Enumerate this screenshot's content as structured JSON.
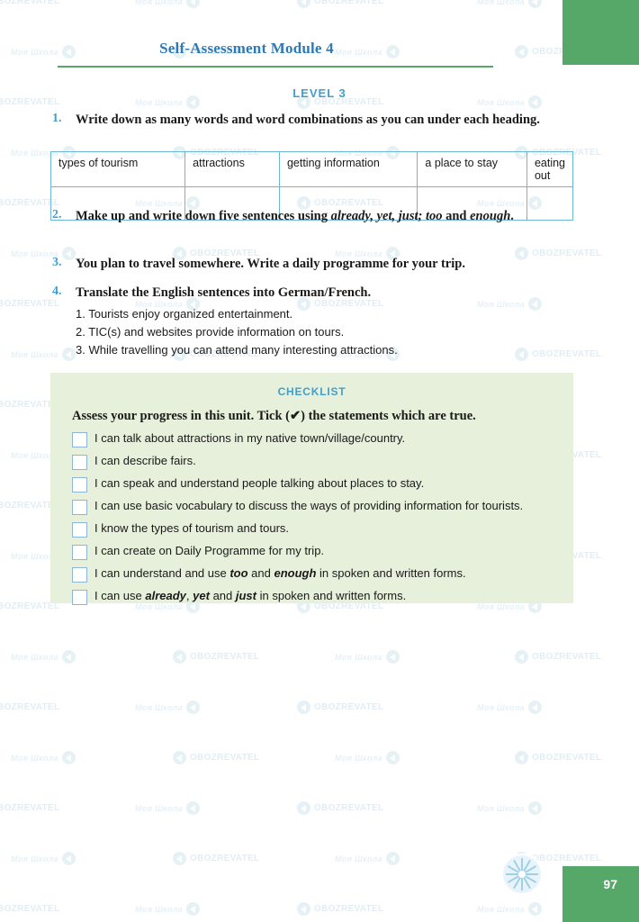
{
  "header": {
    "title": "Self-Assessment Module 4",
    "level": "LEVEL 3"
  },
  "tasks": [
    {
      "num": "1.",
      "text": "Write down as many words and word combinations as you can under each heading."
    },
    {
      "num": "2.",
      "text": "Make up and write down five sentences using already, yet, just; too and enough."
    },
    {
      "num": "3.",
      "text": "You plan to travel somewhere. Write a daily programme for your trip."
    },
    {
      "num": "4.",
      "text": "Translate the English sentences into German/French."
    }
  ],
  "table": {
    "headers": [
      "types of tourism",
      "attractions",
      "getting information",
      "a place to stay",
      "eating out"
    ]
  },
  "sentences": [
    "1. Tourists enjoy organized entertainment.",
    "2. TIC(s) and websites provide information on tours.",
    "3. While travelling you can attend many interesting attractions."
  ],
  "checklist": {
    "title": "CHECKLIST",
    "lead": "Assess your progress in this unit. Tick (✔) the statements which are true.",
    "items": [
      "I can talk about attractions in my native town/village/country.",
      "I can describe fairs.",
      "I can speak and understand people talking about places to stay.",
      "I can use basic vocabulary to discuss the ways of providing information for tourists.",
      "I know the types of tourism and tours.",
      "I can create on Daily Programme for my trip.",
      "I can understand and use too and enough in spoken and written forms.",
      "I can use already, yet and just in spoken and written forms."
    ]
  },
  "footer": {
    "page_number": "97"
  },
  "watermark": {
    "brand": "OBOZREVATEL",
    "school": "Моя Школа"
  },
  "colors": {
    "green": "#56a868",
    "blue": "#3f9fd0",
    "title_blue": "#2f7ab5",
    "checklist_bg": "#e6f0da",
    "table_border": "#6cb7d8"
  }
}
